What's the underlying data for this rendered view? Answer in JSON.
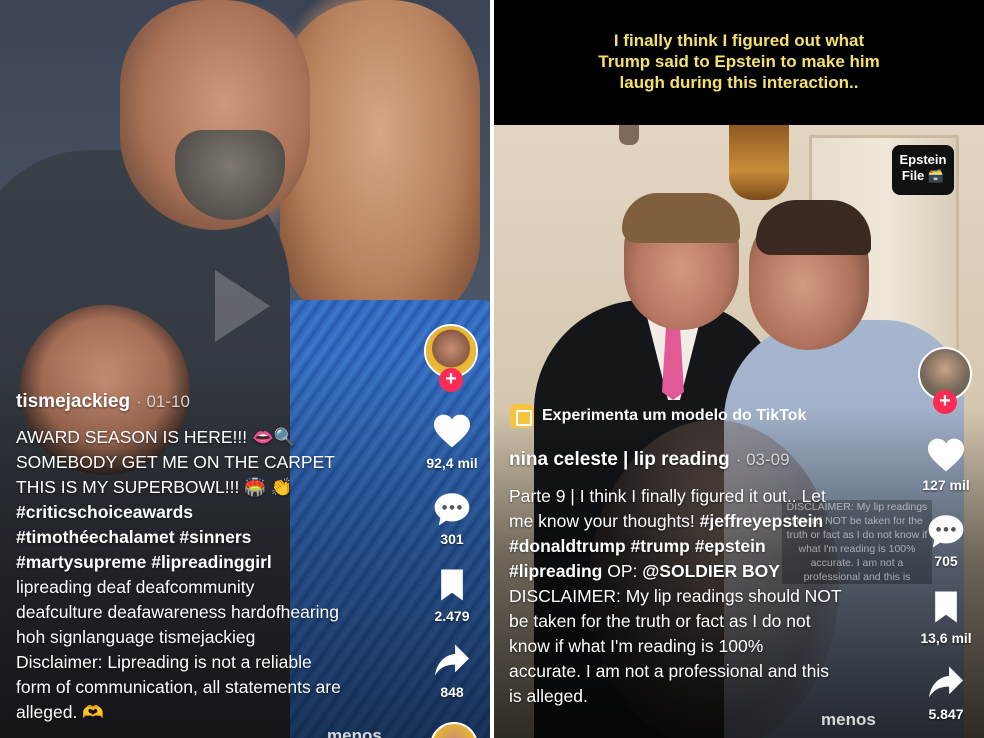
{
  "left": {
    "username": "tismejackieg",
    "date": "· 01-10",
    "description": [
      {
        "text": "AWARD SEASON IS HERE!!! 👄🔍",
        "bold": false
      },
      {
        "text": "SOMEBODY GET ME ON THE CARPET",
        "bold": false
      },
      {
        "text": "THIS IS MY SUPERBOWL!!! 🏟️ 👏",
        "bold": false
      },
      {
        "text": "#criticschoiceawards",
        "bold": true
      },
      {
        "text": "#timothéechalamet #sinners",
        "bold": true
      },
      {
        "text": "#martysupreme #lipreadinggirl",
        "bold": true
      },
      {
        "text": "lipreading deaf deafcommunity",
        "bold": false
      },
      {
        "text": "deafculture deafawareness hardofhearing",
        "bold": false
      },
      {
        "text": "hoh signlanguage tismejackieg",
        "bold": false
      },
      {
        "text": "Disclaimer: Lipreading is not a reliable",
        "bold": false
      },
      {
        "text": "form of communication, all statements are",
        "bold": false
      },
      {
        "text": "alleged. 🫶",
        "bold": false
      }
    ],
    "likes": "92,4 mil",
    "comments": "301",
    "saves": "2.479",
    "shares": "848",
    "menos": "menos",
    "plus": "+"
  },
  "right": {
    "caption": "I finally think I figured out what Trump said to Epstein to make him laugh during this interaction..",
    "badge": "Epstein File 🗃️",
    "ad_banner": "Experimenta um modelo do TikTok",
    "username": "nina celeste | lip reading",
    "date": "· 03-09",
    "description": [
      {
        "parts": [
          {
            "t": "Parte 9",
            "b": false
          },
          {
            "t": " | I think I finally figured it out.. Let",
            "b": false
          }
        ]
      },
      {
        "parts": [
          {
            "t": "me know your thoughts! ",
            "b": false
          },
          {
            "t": "#jeffreyepstein",
            "b": true
          }
        ]
      },
      {
        "parts": [
          {
            "t": "#donaldtrump #trump #epstein",
            "b": true
          }
        ]
      },
      {
        "parts": [
          {
            "t": "#lipreading",
            "b": true
          },
          {
            "t": " OP: ",
            "b": false
          },
          {
            "t": "@SOLDIER BOY",
            "b": true
          }
        ]
      },
      {
        "parts": [
          {
            "t": "DISCLAIMER: My lip readings should NOT",
            "b": false
          }
        ]
      },
      {
        "parts": [
          {
            "t": "be taken for the truth or fact as I do not",
            "b": false
          }
        ]
      },
      {
        "parts": [
          {
            "t": "know if what I'm reading is 100%",
            "b": false
          }
        ]
      },
      {
        "parts": [
          {
            "t": "accurate. I am not a professional and this",
            "b": false
          }
        ]
      },
      {
        "parts": [
          {
            "t": "is alleged.",
            "b": false
          }
        ]
      }
    ],
    "video_disclaimer": "DISCLAIMER: My lip readings should NOT be taken for the truth or fact as I do not know if what I'm reading is 100% accurate. I am not a professional and this is",
    "likes": "127 mil",
    "comments": "705",
    "saves": "13,6 mil",
    "shares": "5.847",
    "menos": "menos",
    "plus": "+"
  },
  "colors": {
    "accent": "#fe2c55",
    "caption": "#f4e06a"
  },
  "icons": {
    "like": "heart-icon",
    "comment": "comment-bubble-icon",
    "save": "bookmark-icon",
    "share": "share-arrow-icon"
  }
}
